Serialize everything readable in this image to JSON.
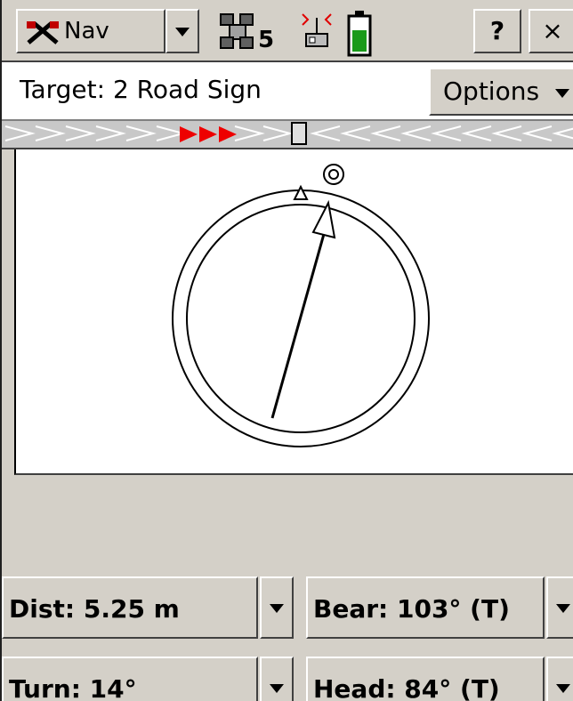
{
  "titlebar": {
    "nav_label": "Nav",
    "satellite_count": "5",
    "help_label": "?",
    "close_label": "×"
  },
  "target": {
    "label": "Target: 2 Road Sign",
    "options_label": "Options"
  },
  "fields": {
    "dist": "Dist: 5.25 m",
    "bear": "Bear: 103° (T)",
    "turn": "Turn: 14°",
    "head": "Head: 84° (T)"
  },
  "compass": {
    "bearing_deg": 103,
    "heading_deg": 84,
    "turn_deg": 14
  },
  "colors": {
    "accent_red": "#ee0000",
    "battery_green": "#1a9a1a",
    "panel": "#d4d0c8"
  },
  "icons": {
    "nav": "nav-crossed-tools-icon",
    "satellite": "satellite-icon",
    "radio": "radio-receiver-icon",
    "battery": "battery-icon"
  }
}
